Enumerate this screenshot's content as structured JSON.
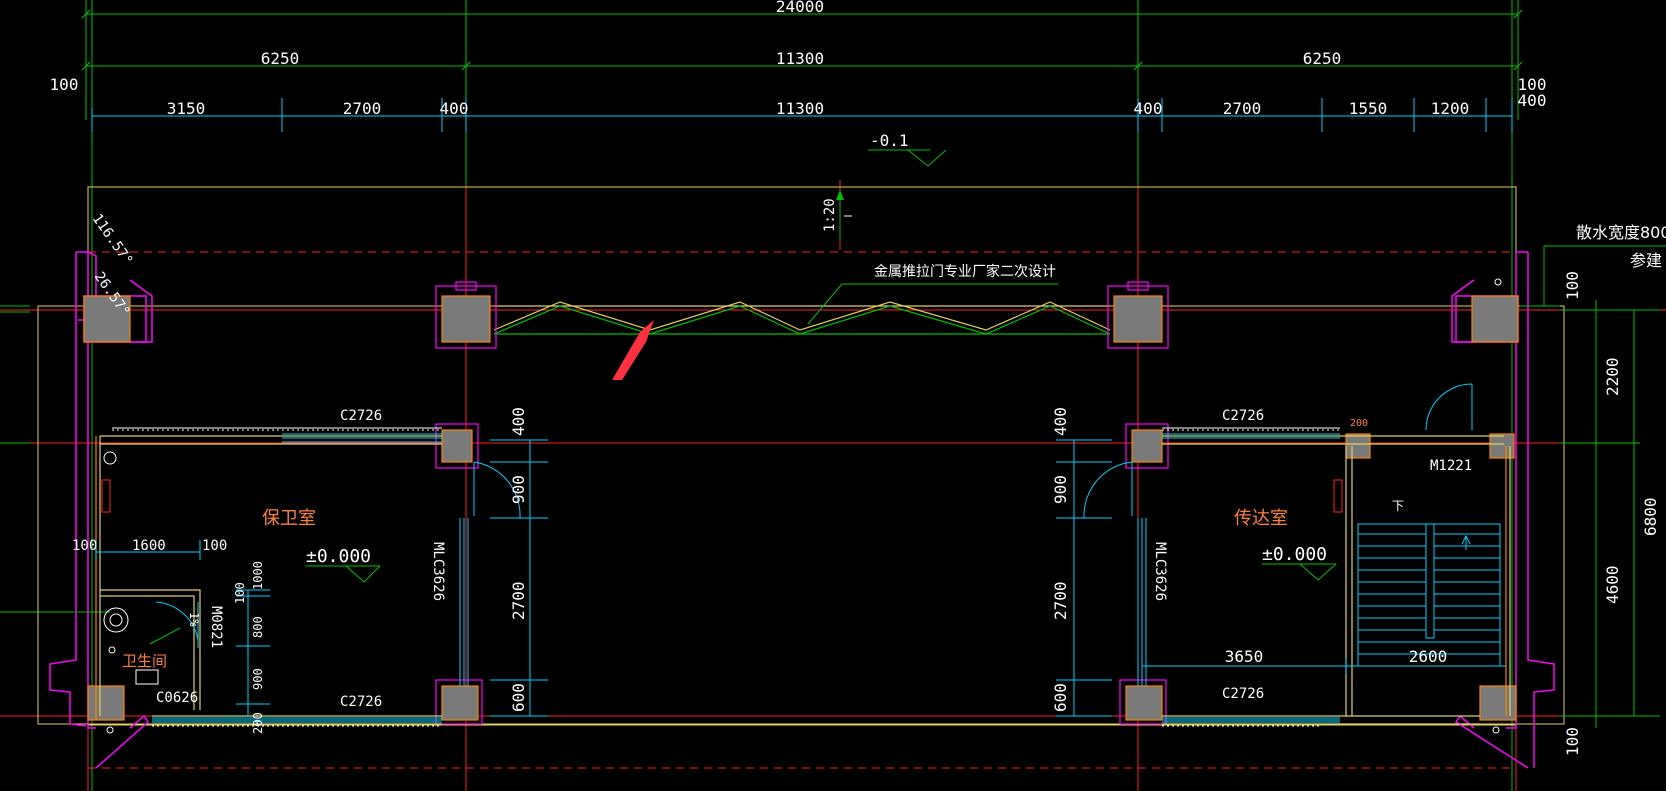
{
  "colors": {
    "background": "#000000",
    "axis_red": "#ff2020",
    "axis_green": "#00c000",
    "wall_yellow": "#e0d060",
    "wall_orange": "#ff8000",
    "column_fill": "#7a7a7a",
    "outline_magenta": "#ff00ff",
    "dim_cyan": "#00d0ff",
    "text_white": "#ffffff",
    "room_text": "#ff8040"
  },
  "dims": {
    "total": "24000",
    "top_left": "6250",
    "top_mid": "11300",
    "top_right": "6250",
    "left_100": "100",
    "right_100a": "100",
    "right_400": "400",
    "r2": [
      "3150",
      "2700",
      "400",
      "11300",
      "400",
      "2700",
      "1550",
      "1200"
    ]
  },
  "elevation_top": "-0.1",
  "scale_note": "1:20",
  "gate_note": "金属推拉门专业厂家二次设计",
  "apron_note": "散水宽度800",
  "apron_note2": "参建",
  "angles": [
    "116.57°",
    "26.57°"
  ],
  "left_room": {
    "name": "保卫室",
    "elevation": "±0.000",
    "window_top": "C2726",
    "window_bottom": "C2726",
    "side_window": "MLC3626",
    "door": "M0821",
    "door2": "1%",
    "toilet": "卫生间",
    "toilet_window": "C0626",
    "d100a": "100",
    "d1600": "1600",
    "d100b": "100",
    "v100": "100",
    "v800": "800",
    "v900": "900",
    "v200": "200",
    "v1000": "1000"
  },
  "right_room": {
    "name": "传达室",
    "elevation": "±0.000",
    "window_top": "C2726",
    "window_bottom": "C2726",
    "side_window": "MLC3626",
    "door": "M1221",
    "d3650": "3650",
    "d2600": "2600",
    "d200": "200",
    "stair_down": "下"
  },
  "left_vdims": [
    "400",
    "900",
    "2700",
    "600"
  ],
  "right_vdims": [
    "400",
    "900",
    "2700",
    "600"
  ],
  "far_right_vdims": [
    "100",
    "2200",
    "4600",
    "6800",
    "100"
  ]
}
